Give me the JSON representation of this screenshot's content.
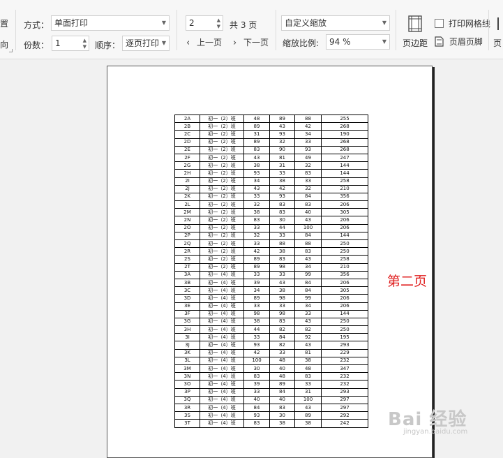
{
  "toolbar": {
    "left_partial_top": "置",
    "left_partial_bottom": "向",
    "mode_label": "方式：",
    "mode_value": "单面打印",
    "copies_label": "份数：",
    "copies_value": "1",
    "order_label": "顺序：",
    "order_value": "逐页打印",
    "page_value": "2",
    "page_total": "共 3 页",
    "prev_page": "上一页",
    "next_page": "下一页",
    "zoom_mode": "自定义缩放",
    "zoom_label": "缩放比例:",
    "zoom_value": "94 %",
    "margins_label": "页边距",
    "print_gridlines": "打印网格线",
    "print_gridlines_checked": false,
    "header_footer": "页眉页脚",
    "partial_right": "页"
  },
  "preview": {
    "page_label": "第二页",
    "watermark_main": "Bai 经验",
    "watermark_sub": "jingyan.baidu.com"
  },
  "table_rows": [
    [
      "2A",
      "初一（2）班",
      "48",
      "89",
      "88",
      "255"
    ],
    [
      "2B",
      "初一（2）班",
      "89",
      "43",
      "42",
      "268"
    ],
    [
      "2C",
      "初一（2）班",
      "31",
      "93",
      "34",
      "190"
    ],
    [
      "2D",
      "初一（2）班",
      "89",
      "32",
      "33",
      "268"
    ],
    [
      "2E",
      "初一（2）班",
      "83",
      "90",
      "93",
      "268"
    ],
    [
      "2F",
      "初一（2）班",
      "43",
      "81",
      "49",
      "247"
    ],
    [
      "2G",
      "初一（2）班",
      "38",
      "31",
      "32",
      "144"
    ],
    [
      "2H",
      "初一（2）班",
      "93",
      "33",
      "83",
      "144"
    ],
    [
      "2I",
      "初一（2）班",
      "34",
      "38",
      "33",
      "258"
    ],
    [
      "2J",
      "初一（2）班",
      "43",
      "42",
      "32",
      "210"
    ],
    [
      "2K",
      "初一（2）班",
      "33",
      "93",
      "84",
      "356"
    ],
    [
      "2L",
      "初一（2）班",
      "32",
      "83",
      "83",
      "206"
    ],
    [
      "2M",
      "初一（2）班",
      "38",
      "83",
      "40",
      "305"
    ],
    [
      "2N",
      "初一（2）班",
      "83",
      "30",
      "43",
      "206"
    ],
    [
      "2O",
      "初一（2）班",
      "33",
      "44",
      "100",
      "206"
    ],
    [
      "2P",
      "初一（2）班",
      "32",
      "33",
      "84",
      "144"
    ],
    [
      "2Q",
      "初一（2）班",
      "33",
      "88",
      "88",
      "250"
    ],
    [
      "2R",
      "初一（2）班",
      "42",
      "38",
      "83",
      "250"
    ],
    [
      "2S",
      "初一（2）班",
      "89",
      "83",
      "43",
      "258"
    ],
    [
      "2T",
      "初一（2）班",
      "89",
      "98",
      "34",
      "210"
    ],
    [
      "3A",
      "初一（4）班",
      "33",
      "33",
      "99",
      "356"
    ],
    [
      "3B",
      "初一（4）班",
      "39",
      "43",
      "84",
      "206"
    ],
    [
      "3C",
      "初一（4）班",
      "34",
      "38",
      "84",
      "305"
    ],
    [
      "3D",
      "初一（4）班",
      "89",
      "98",
      "99",
      "206"
    ],
    [
      "3E",
      "初一（4）班",
      "33",
      "33",
      "34",
      "206"
    ],
    [
      "3F",
      "初一（4）班",
      "98",
      "98",
      "33",
      "144"
    ],
    [
      "3G",
      "初一（4）班",
      "38",
      "83",
      "43",
      "250"
    ],
    [
      "3H",
      "初一（4）班",
      "44",
      "82",
      "82",
      "250"
    ],
    [
      "3I",
      "初一（4）班",
      "33",
      "84",
      "92",
      "195"
    ],
    [
      "3J",
      "初一（4）班",
      "93",
      "82",
      "43",
      "293"
    ],
    [
      "3K",
      "初一（4）班",
      "42",
      "33",
      "81",
      "229"
    ],
    [
      "3L",
      "初一（4）班",
      "100",
      "48",
      "38",
      "232"
    ],
    [
      "3M",
      "初一（4）班",
      "30",
      "40",
      "48",
      "347"
    ],
    [
      "3N",
      "初一（4）班",
      "83",
      "48",
      "83",
      "232"
    ],
    [
      "3O",
      "初一（4）班",
      "39",
      "89",
      "33",
      "232"
    ],
    [
      "3P",
      "初一（4）班",
      "33",
      "84",
      "31",
      "293"
    ],
    [
      "3Q",
      "初一（4）班",
      "40",
      "40",
      "100",
      "297"
    ],
    [
      "3R",
      "初一（4）班",
      "84",
      "83",
      "43",
      "297"
    ],
    [
      "3S",
      "初一（4）班",
      "93",
      "30",
      "89",
      "292"
    ],
    [
      "3T",
      "初一（4）班",
      "83",
      "38",
      "38",
      "242"
    ]
  ]
}
